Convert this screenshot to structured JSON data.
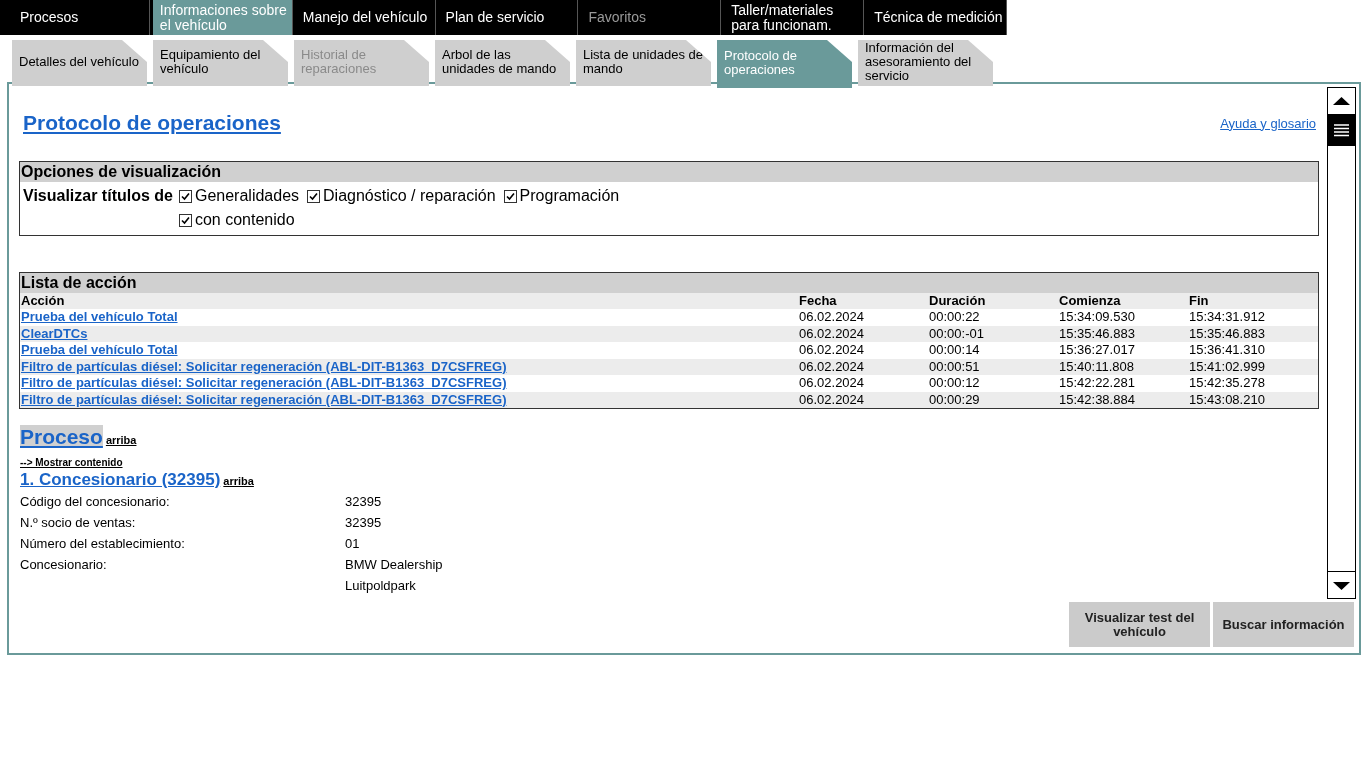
{
  "main_tabs": [
    {
      "label": "Procesos",
      "selected": false,
      "disabled": false
    },
    {
      "label": "Informaciones sobre el vehículo",
      "selected": true,
      "disabled": false
    },
    {
      "label": "Manejo del vehículo",
      "selected": false,
      "disabled": false
    },
    {
      "label": "Plan de servicio",
      "selected": false,
      "disabled": false
    },
    {
      "label": "Favoritos",
      "selected": false,
      "disabled": true
    },
    {
      "label": "Taller/materiales para funcionam.",
      "selected": false,
      "disabled": false
    },
    {
      "label": "Técnica de medición",
      "selected": false,
      "disabled": false
    }
  ],
  "sub_tabs": [
    {
      "label": "Detalles del vehículo",
      "selected": false,
      "disabled": false
    },
    {
      "label": "Equipamiento del vehículo",
      "selected": false,
      "disabled": false
    },
    {
      "label": "Historial de reparaciones",
      "selected": false,
      "disabled": true
    },
    {
      "label": "Arbol de las unidades de mando",
      "selected": false,
      "disabled": false
    },
    {
      "label": "Lista de unidades de mando",
      "selected": false,
      "disabled": false
    },
    {
      "label": "Protocolo de operaciones",
      "selected": true,
      "disabled": false
    },
    {
      "label": "Información del asesoramiento del servicio",
      "selected": false,
      "disabled": false
    }
  ],
  "page": {
    "title": "Protocolo de operaciones",
    "help_link": "Ayuda y glosario"
  },
  "display_options": {
    "title": "Opciones de visualización",
    "label": "Visualizar títulos de",
    "options": [
      {
        "label": "Generalidades",
        "checked": true
      },
      {
        "label": "Diagnóstico / reparación",
        "checked": true
      },
      {
        "label": "Programación",
        "checked": true
      },
      {
        "label": "con contenido",
        "checked": true
      }
    ]
  },
  "action_list": {
    "title": "Lista de acción",
    "columns": [
      "Acción",
      "Fecha",
      "Duración",
      "Comienza",
      "Fin"
    ],
    "rows": [
      [
        "Prueba del vehículo Total",
        "06.02.2024",
        "00:00:22",
        "15:34:09.530",
        "15:34:31.912"
      ],
      [
        "ClearDTCs",
        "06.02.2024",
        "00:00:-01",
        "15:35:46.883",
        "15:35:46.883"
      ],
      [
        "Prueba del vehículo Total",
        "06.02.2024",
        "00:00:14",
        "15:36:27.017",
        "15:36:41.310"
      ],
      [
        "Filtro de partículas diésel: Solicitar regeneración (ABL-DIT-B1363_D7CSFREG)",
        "06.02.2024",
        "00:00:51",
        "15:40:11.808",
        "15:41:02.999"
      ],
      [
        "Filtro de partículas diésel: Solicitar regeneración (ABL-DIT-B1363_D7CSFREG)",
        "06.02.2024",
        "00:00:12",
        "15:42:22.281",
        "15:42:35.278"
      ],
      [
        "Filtro de partículas diésel: Solicitar regeneración (ABL-DIT-B1363_D7CSFREG)",
        "06.02.2024",
        "00:00:29",
        "15:42:38.884",
        "15:43:08.210"
      ]
    ]
  },
  "process": {
    "title": "Proceso",
    "top_link": "arriba",
    "show_content": "--> Mostrar contenido",
    "sections": [
      {
        "title": "1. Concesionario (32395)",
        "top_link": "arriba",
        "fields": [
          {
            "label": "Código del concesionario:",
            "values": [
              "32395"
            ]
          },
          {
            "label": "N.º socio de ventas:",
            "values": [
              "32395"
            ]
          },
          {
            "label": "Número del establecimiento:",
            "values": [
              "01"
            ]
          },
          {
            "label": "Concesionario:",
            "values": [
              "BMW Dealership",
              "Luitpoldpark"
            ]
          }
        ]
      }
    ]
  },
  "buttons": [
    "Visualizar test del vehículo",
    "Buscar información"
  ]
}
